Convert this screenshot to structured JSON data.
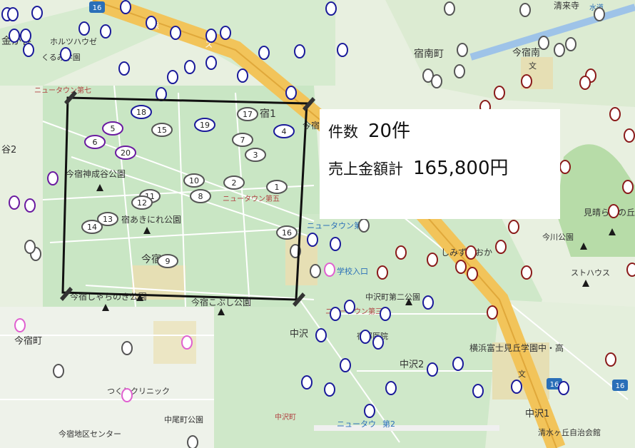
{
  "map": {
    "roads": [
      {
        "label": "16"
      },
      {
        "label": "16"
      },
      {
        "label": "16"
      }
    ],
    "places": [
      {
        "label": "金が谷"
      },
      {
        "label": "ホルツハウゼ"
      },
      {
        "label": "くるみ学園"
      },
      {
        "label": "ニュータウン第七"
      },
      {
        "label": "谷2"
      },
      {
        "label": "今宿神成谷公園"
      },
      {
        "label": "宿あきにれ公園"
      },
      {
        "label": "今宿"
      },
      {
        "label": "今宿しゃちのき公園"
      },
      {
        "label": "今宿こぶし公園"
      },
      {
        "label": "ニュータウン第五"
      },
      {
        "label": "宿1"
      },
      {
        "label": "今宿"
      },
      {
        "label": "宿南町"
      },
      {
        "label": "今宿南"
      },
      {
        "label": "清来寺"
      },
      {
        "label": "水道"
      },
      {
        "label": "ニュータウン第"
      },
      {
        "label": "中"
      },
      {
        "label": "学校入口"
      },
      {
        "label": "しみずがおか"
      },
      {
        "label": "見晴らしの丘"
      },
      {
        "label": "今川公園"
      },
      {
        "label": "ストハウス"
      },
      {
        "label": "中沢町第二公園"
      },
      {
        "label": "ニュータウン第三"
      },
      {
        "label": "中沢"
      },
      {
        "label": "宿部医院"
      },
      {
        "label": "中沢2"
      },
      {
        "label": "横浜富士見丘学園中・高"
      },
      {
        "label": "文"
      },
      {
        "label": "今宿町"
      },
      {
        "label": "つくしクリニック"
      },
      {
        "label": "中尾町公園"
      },
      {
        "label": "中沢町"
      },
      {
        "label": "ニュータウ"
      },
      {
        "label": "第2"
      },
      {
        "label": "今宿地区センター"
      },
      {
        "label": "清水ヶ丘自治会館"
      },
      {
        "label": "中沢1"
      },
      {
        "label": "文"
      },
      {
        "label": "保"
      },
      {
        "label": "ス"
      }
    ],
    "markers": [
      {
        "number": "1"
      },
      {
        "number": "2"
      },
      {
        "number": "3"
      },
      {
        "number": "4"
      },
      {
        "number": "5"
      },
      {
        "number": "6"
      },
      {
        "number": "7"
      },
      {
        "number": "8"
      },
      {
        "number": "9"
      },
      {
        "number": "10"
      },
      {
        "number": "11"
      },
      {
        "number": "12"
      },
      {
        "number": "13"
      },
      {
        "number": "14"
      },
      {
        "number": "15"
      },
      {
        "number": "16"
      },
      {
        "number": "17"
      },
      {
        "number": "18"
      },
      {
        "number": "19"
      },
      {
        "number": "20"
      }
    ]
  },
  "stats": {
    "count_label": "件数",
    "count_value": "20件",
    "total_label": "売上金額計",
    "total_value": "165,800円"
  },
  "colors": {
    "background": "#e8f0e0",
    "residential": "#c9e6c4",
    "highway": "#f2c45a",
    "marker_blue": "#1a1a9a",
    "marker_purple": "#6a1aa0",
    "marker_red": "#8a1a1a",
    "marker_gray": "#555555",
    "marker_pink": "#e060d0",
    "selection": "#111111"
  }
}
